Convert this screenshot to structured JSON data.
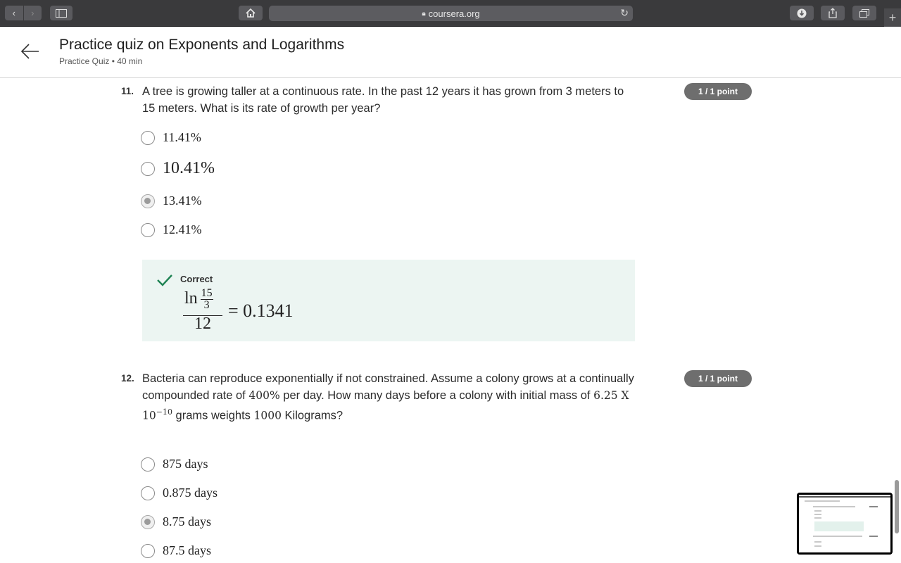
{
  "browser": {
    "url": "coursera.org",
    "icons": [
      "back-arrow-icon",
      "forward-arrow-icon",
      "sidebar-icon",
      "home-icon",
      "lock-icon",
      "reload-icon",
      "download-icon",
      "share-icon",
      "tabs-icon",
      "new-tab-icon"
    ]
  },
  "header": {
    "title": "Practice quiz on Exponents and Logarithms",
    "subtitle": "Practice Quiz • 40 min"
  },
  "questions": [
    {
      "number": "11.",
      "text": "A tree is growing taller at a continuous rate. In the past 12 years it has grown from 3 meters to 15 meters. What is its rate of growth per year?",
      "points": "1 / 1 point",
      "options": [
        {
          "label": "11.41%",
          "selected": false
        },
        {
          "label": "10.41%",
          "selected": false
        },
        {
          "label": "13.41%",
          "selected": true
        },
        {
          "label": "12.41%",
          "selected": false
        }
      ],
      "feedback": {
        "status": "Correct",
        "formula": {
          "fn": "ln",
          "inner_num": "15",
          "inner_den": "3",
          "den": "12",
          "rhs": "= 0.1341"
        }
      }
    },
    {
      "number": "12.",
      "text_parts": {
        "p1": "Bacteria can reproduce exponentially if not constrained. Assume a colony grows at a continually compounded rate of ",
        "rate": "400%",
        "p2": " per day. How many days before a colony with initial mass of ",
        "mass": "6.25 X 10",
        "exp": "−10",
        "p3": " grams weights ",
        "weight": "1000",
        "p4": " Kilograms?"
      },
      "points": "1 / 1 point",
      "options": [
        {
          "label": "875 days",
          "selected": false
        },
        {
          "label": "0.875 days",
          "selected": false
        },
        {
          "label": "8.75 days",
          "selected": true
        },
        {
          "label": "87.5 days",
          "selected": false
        }
      ]
    }
  ],
  "colors": {
    "accent_green": "#1f8354",
    "feedback_bg": "#ecf5f2",
    "points_badge": "#6e6e6e"
  }
}
